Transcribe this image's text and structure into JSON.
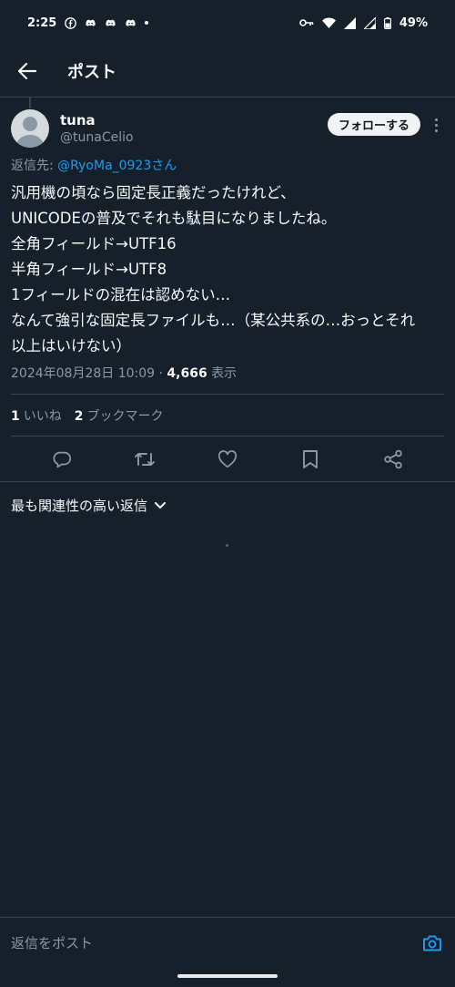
{
  "status_bar": {
    "time": "2:25",
    "battery": "49%"
  },
  "header": {
    "title": "ポスト"
  },
  "tweet": {
    "display_name": "tuna",
    "handle": "@tunaCelio",
    "follow_label": "フォローする",
    "reply_prefix": "返信先: ",
    "reply_mention": "@RyoMa_0923さん",
    "lines": [
      "汎用機の頃なら固定長正義だったけれど、",
      "UNICODEの普及でそれも駄目になりましたね。",
      "全角フィールド→UTF16",
      "半角フィールド→UTF8",
      "1フィールドの混在は認めない…",
      "なんて強引な固定長ファイルも…（某公共系の…おっとそれ",
      "以上はいけない）"
    ],
    "timestamp": "2024年08月28日 10:09 · ",
    "views_count": "4,666",
    "views_label": " 表示",
    "likes_count": "1",
    "likes_label": "いいね",
    "bookmarks_count": "2",
    "bookmarks_label": "ブックマーク"
  },
  "replies": {
    "sort_label": "最も関連性の高い返信"
  },
  "compose": {
    "placeholder": "返信をポスト"
  },
  "colors": {
    "background": "#15202b",
    "accent": "#1d9bf0",
    "secondary_text": "#8b98a5",
    "divider": "#38444d"
  },
  "icons": [
    "facebook-icon",
    "discord-icon",
    "key-icon",
    "wifi-icon",
    "signal-icon",
    "battery-icon",
    "back-arrow-icon",
    "reply-icon",
    "retweet-icon",
    "like-icon",
    "bookmark-icon",
    "share-icon",
    "chevron-down-icon",
    "camera-icon"
  ]
}
